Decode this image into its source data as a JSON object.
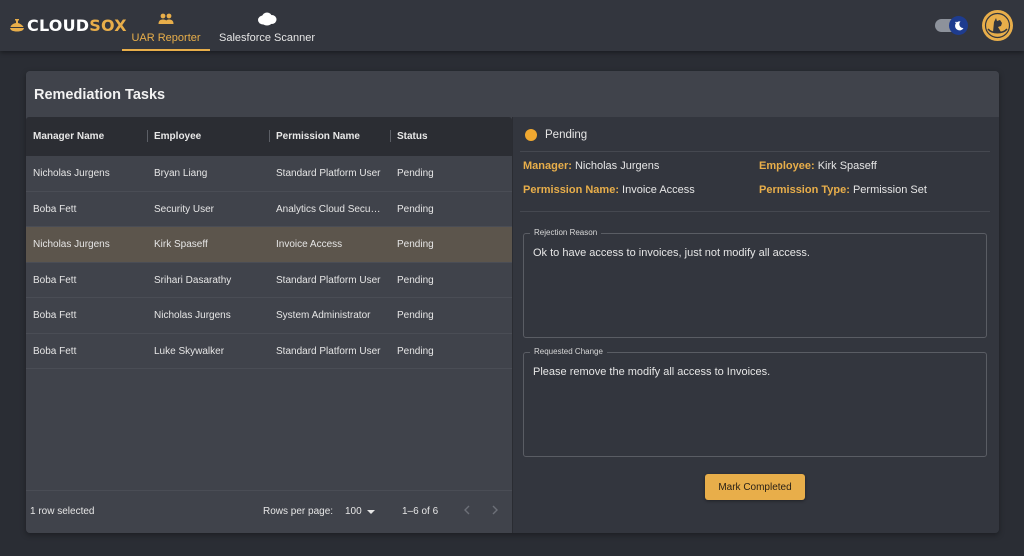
{
  "app": {
    "logo_part1": "CLOUD",
    "logo_part2": "SOX",
    "brand_color": "#e8ae4a"
  },
  "nav": {
    "tabs": [
      {
        "label": "UAR Reporter",
        "icon": "people-icon",
        "active": true
      },
      {
        "label": "Salesforce Scanner",
        "icon": "salesforce-cloud-icon",
        "active": false
      }
    ]
  },
  "header_controls": {
    "theme_toggle": {
      "icon": "moon-icon",
      "state": "dark"
    },
    "avatar": {
      "icon": "fox-logo-icon"
    }
  },
  "page": {
    "title": "Remediation Tasks"
  },
  "table": {
    "columns": [
      "Manager Name",
      "Employee",
      "Permission Name",
      "Status"
    ],
    "rows": [
      {
        "manager": "Nicholas Jurgens",
        "employee": "Bryan Liang",
        "permission": "Standard Platform User",
        "status": "Pending",
        "selected": false
      },
      {
        "manager": "Boba Fett",
        "employee": "Security User",
        "permission": "Analytics Cloud Secu…",
        "status": "Pending",
        "selected": false
      },
      {
        "manager": "Nicholas Jurgens",
        "employee": "Kirk Spaseff",
        "permission": "Invoice Access",
        "status": "Pending",
        "selected": true
      },
      {
        "manager": "Boba Fett",
        "employee": "Srihari Dasarathy",
        "permission": "Standard Platform User",
        "status": "Pending",
        "selected": false
      },
      {
        "manager": "Boba Fett",
        "employee": "Nicholas Jurgens",
        "permission": "System Administrator",
        "status": "Pending",
        "selected": false
      },
      {
        "manager": "Boba Fett",
        "employee": "Luke Skywalker",
        "permission": "Standard Platform User",
        "status": "Pending",
        "selected": false
      }
    ],
    "footer": {
      "selection_text": "1 row selected",
      "rows_per_page_label": "Rows per page:",
      "rows_per_page_value": "100",
      "range_text": "1–6 of 6"
    }
  },
  "detail": {
    "status": "Pending",
    "status_color": "#f0a830",
    "fields": {
      "manager_label": "Manager:",
      "manager_value": "Nicholas Jurgens",
      "employee_label": "Employee:",
      "employee_value": "Kirk Spaseff",
      "permission_name_label": "Permission Name:",
      "permission_name_value": "Invoice Access",
      "permission_type_label": "Permission Type:",
      "permission_type_value": "Permission Set"
    },
    "rejection_reason": {
      "label": "Rejection Reason",
      "value": "Ok to have access to invoices, just not modify all access."
    },
    "requested_change": {
      "label": "Requested Change",
      "value": "Please remove the modify all access to Invoices."
    },
    "action_label": "Mark Completed"
  }
}
